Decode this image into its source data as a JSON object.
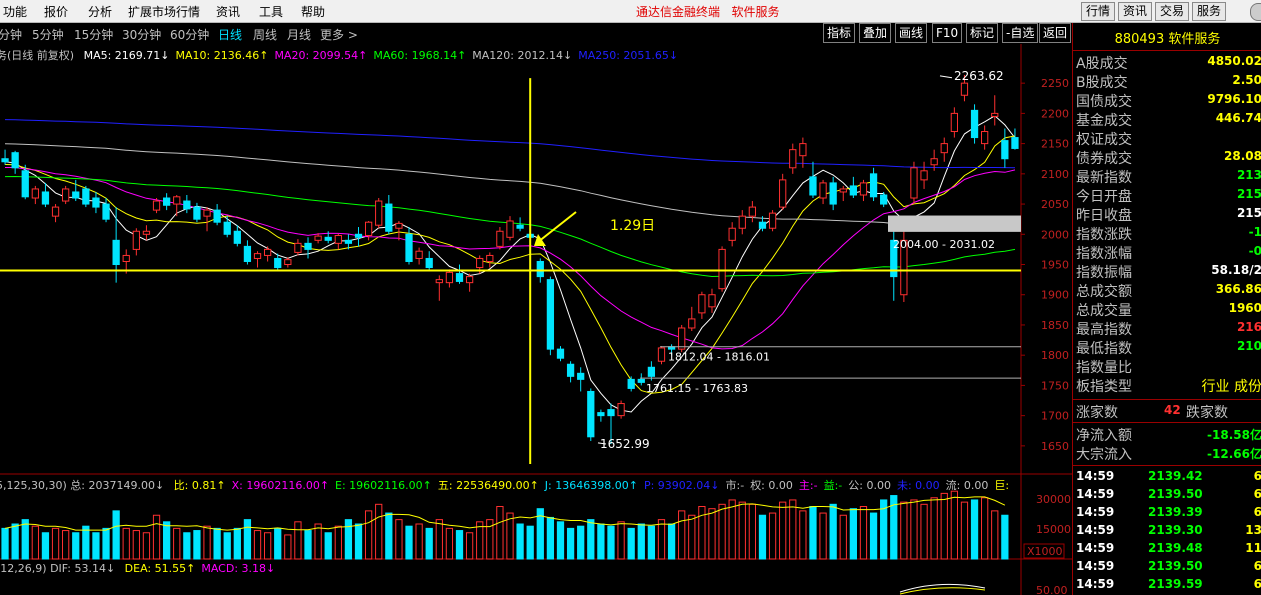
{
  "menu": [
    "功能",
    "报价",
    "分析",
    "扩展市场行情",
    "资讯",
    "工具",
    "帮助"
  ],
  "brand": "通达信金融终端",
  "brand_sub": "软件服务",
  "top_buttons": [
    "行情",
    "资讯",
    "交易",
    "服务"
  ],
  "periods": [
    "分钟",
    "5分钟",
    "15分钟",
    "30分钟",
    "60分钟",
    "日线",
    "周线",
    "月线",
    "更多 >"
  ],
  "active_period": "日线",
  "tools": [
    "指标",
    "叠加",
    "画线",
    "F10",
    "标记",
    "-自选",
    "返回"
  ],
  "ma_line": {
    "prefix": "务(日线 前复权)",
    "items": [
      {
        "label": "MA5: 2169.71↓",
        "color": "#ffffff"
      },
      {
        "label": "MA10: 2136.46↑",
        "color": "#ffff00"
      },
      {
        "label": "MA20: 2099.54↑",
        "color": "#ff00ff"
      },
      {
        "label": "MA60: 1968.14↑",
        "color": "#00ff00"
      },
      {
        "label": "MA120: 2012.14↓",
        "color": "#c0c0c0"
      },
      {
        "label": "MA250: 2051.65↓",
        "color": "#2020ff"
      }
    ]
  },
  "annotation": "1.29日",
  "price_labels": {
    "high": "2263.62",
    "low": "1652.99",
    "box1": "2004.00 - 2031.02",
    "box2": "1812.04 - 1816.01",
    "box3": "1761.15 - 1763.83"
  },
  "y_axis": [
    "2250",
    "2200",
    "2150",
    "2100",
    "2050",
    "2000",
    "1950",
    "1900",
    "1850",
    "1800",
    "1750",
    "1700",
    "1650"
  ],
  "vol_line": {
    "prefix": "5,125,30,30) 总: 2037149.00↓",
    "items": [
      {
        "label": "比: 0.81↑",
        "color": "#ffff00"
      },
      {
        "label": "X: 19602116.00↑",
        "color": "#ff00ff"
      },
      {
        "label": "E: 19602116.00↑",
        "color": "#00ff00"
      },
      {
        "label": "五: 22536490.00↑",
        "color": "#ffff00"
      },
      {
        "label": "J: 13646398.00↑",
        "color": "#00e0ff"
      },
      {
        "label": "P: 93902.04↓",
        "color": "#2020ff"
      },
      {
        "label": "市:-",
        "color": "#c0c0c0"
      },
      {
        "label": "权: 0.00",
        "color": "#c0c0c0"
      },
      {
        "label": "主:-",
        "color": "#ff00ff"
      },
      {
        "label": "益:-",
        "color": "#00ff00"
      },
      {
        "label": "公: 0.00",
        "color": "#c0c0c0"
      },
      {
        "label": "未: 0.00",
        "color": "#2020ff"
      },
      {
        "label": "流: 0.00",
        "color": "#c0c0c0"
      },
      {
        "label": "巨:",
        "color": "#ffff00"
      }
    ]
  },
  "vol_axis": [
    "30000",
    "15000"
  ],
  "vol_unit": "X1000",
  "macd_line": {
    "prefix": "(12,26,9) DIF: 53.14↓",
    "items": [
      {
        "label": "DEA: 51.55↑",
        "color": "#ffff00"
      },
      {
        "label": "MACD: 3.18↓",
        "color": "#ff00ff"
      }
    ]
  },
  "macd_axis": "50.00",
  "right_panel": {
    "code": "880493",
    "name": "软件服务",
    "rows": [
      {
        "label": "A股成交",
        "value": "4850.02",
        "color": "#ffff00"
      },
      {
        "label": "B股成交",
        "value": "2.50",
        "color": "#ffff00"
      },
      {
        "label": "国债成交",
        "value": "9796.10",
        "color": "#ffff00"
      },
      {
        "label": "基金成交",
        "value": "446.74",
        "color": "#ffff00"
      },
      {
        "label": "权证成交",
        "value": "",
        "color": "#ffff00"
      },
      {
        "label": "债券成交",
        "value": "28.08",
        "color": "#ffff00"
      },
      {
        "label": "最新指数",
        "value": "213",
        "color": "#00ff00"
      },
      {
        "label": "今日开盘",
        "value": "215",
        "color": "#00ff00"
      },
      {
        "label": "昨日收盘",
        "value": "215",
        "color": "#ffffff"
      },
      {
        "label": "指数涨跌",
        "value": "-1",
        "color": "#00ff00"
      },
      {
        "label": "指数涨幅",
        "value": "-0",
        "color": "#00ff00"
      },
      {
        "label": "指数振幅",
        "value": "58.18/2",
        "color": "#ffffff"
      },
      {
        "label": "总成交额",
        "value": "366.86",
        "color": "#ffff00"
      },
      {
        "label": "总成交量",
        "value": "1960",
        "color": "#ffff00"
      },
      {
        "label": "最高指数",
        "value": "216",
        "color": "#ff3030"
      },
      {
        "label": "最低指数",
        "value": "210",
        "color": "#00ff00"
      },
      {
        "label": "指数量比",
        "value": "",
        "color": "#ffffff"
      },
      {
        "label": "板指类型",
        "value": "行业 成份",
        "color": "#ffff00"
      }
    ],
    "up_label": "涨家数",
    "up_value": "42",
    "down_label": "跌家数",
    "net_label": "净流入额",
    "net_value": "-18.58亿",
    "block_label": "大宗流入",
    "block_value": "-12.66亿",
    "ticks": [
      {
        "time": "14:59",
        "price": "2139.42",
        "vol": "6"
      },
      {
        "time": "14:59",
        "price": "2139.50",
        "vol": "6"
      },
      {
        "time": "14:59",
        "price": "2139.39",
        "vol": "6"
      },
      {
        "time": "14:59",
        "price": "2139.30",
        "vol": "13"
      },
      {
        "time": "14:59",
        "price": "2139.48",
        "vol": "11"
      },
      {
        "time": "14:59",
        "price": "2139.50",
        "vol": "6"
      },
      {
        "time": "14:59",
        "price": "2139.59",
        "vol": "6"
      }
    ]
  },
  "chart_data": {
    "type": "candlestick",
    "y_range": [
      1620,
      2285
    ],
    "candles": [
      [
        2125,
        2140,
        2115,
        2120
      ],
      [
        2135,
        2138,
        2100,
        2110
      ],
      [
        2105,
        2115,
        2058,
        2062
      ],
      [
        2060,
        2080,
        2050,
        2075
      ],
      [
        2070,
        2085,
        2045,
        2050
      ],
      [
        2030,
        2050,
        2020,
        2045
      ],
      [
        2055,
        2080,
        2050,
        2075
      ],
      [
        2070,
        2090,
        2055,
        2060
      ],
      [
        2075,
        2080,
        2045,
        2050
      ],
      [
        2060,
        2070,
        2035,
        2045
      ],
      [
        2050,
        2060,
        2020,
        2025
      ],
      [
        1990,
        2045,
        1920,
        1950
      ],
      [
        1955,
        1975,
        1935,
        1965
      ],
      [
        1975,
        2010,
        1965,
        2005
      ],
      [
        2000,
        2015,
        1990,
        2005
      ],
      [
        2040,
        2060,
        2035,
        2055
      ],
      [
        2060,
        2068,
        2040,
        2048
      ],
      [
        2050,
        2065,
        2030,
        2062
      ],
      [
        2055,
        2065,
        2035,
        2042
      ],
      [
        2045,
        2052,
        2020,
        2025
      ],
      [
        2030,
        2045,
        2005,
        2040
      ],
      [
        2040,
        2050,
        2015,
        2020
      ],
      [
        2020,
        2030,
        1995,
        2000
      ],
      [
        2005,
        2015,
        1980,
        1985
      ],
      [
        1980,
        1990,
        1950,
        1955
      ],
      [
        1960,
        1972,
        1945,
        1968
      ],
      [
        1965,
        1980,
        1955,
        1975
      ],
      [
        1960,
        1968,
        1940,
        1945
      ],
      [
        1950,
        1962,
        1945,
        1958
      ],
      [
        1970,
        1992,
        1965,
        1985
      ],
      [
        1985,
        1995,
        1960,
        1975
      ],
      [
        1990,
        2002,
        1985,
        1997
      ],
      [
        1995,
        2005,
        1985,
        1990
      ],
      [
        1985,
        2001,
        1975,
        1998
      ],
      [
        1990,
        2000,
        1975,
        1985
      ],
      [
        2000,
        2012,
        1980,
        1995
      ],
      [
        1998,
        2022,
        1990,
        2020
      ],
      [
        2015,
        2060,
        2010,
        2055
      ],
      [
        2050,
        2065,
        2000,
        2005
      ],
      [
        2010,
        2022,
        1990,
        2018
      ],
      [
        2000,
        2012,
        1950,
        1955
      ],
      [
        1960,
        1978,
        1950,
        1972
      ],
      [
        1960,
        1972,
        1940,
        1945
      ],
      [
        1920,
        1932,
        1890,
        1925
      ],
      [
        1920,
        1942,
        1912,
        1937
      ],
      [
        1935,
        1950,
        1918,
        1922
      ],
      [
        1920,
        1935,
        1905,
        1930
      ],
      [
        1945,
        1965,
        1935,
        1960
      ],
      [
        1955,
        1970,
        1945,
        1965
      ],
      [
        1980,
        2012,
        1975,
        2005
      ],
      [
        1995,
        2030,
        1990,
        2022
      ],
      [
        2015,
        2028,
        2005,
        2010
      ],
      [
        2000,
        2010,
        1990,
        1995
      ],
      [
        1955,
        1960,
        1920,
        1930
      ],
      [
        1925,
        1930,
        1800,
        1810
      ],
      [
        1810,
        1815,
        1790,
        1795
      ],
      [
        1785,
        1790,
        1755,
        1765
      ],
      [
        1770,
        1780,
        1740,
        1760
      ],
      [
        1740,
        1745,
        1658,
        1665
      ],
      [
        1705,
        1710,
        1690,
        1700
      ],
      [
        1710,
        1720,
        1652.99,
        1700
      ],
      [
        1700,
        1725,
        1695,
        1720
      ],
      [
        1760,
        1765,
        1740,
        1745
      ],
      [
        1760,
        1770,
        1750,
        1755
      ],
      [
        1780,
        1790,
        1758,
        1765
      ],
      [
        1790,
        1815,
        1785,
        1812
      ],
      [
        1814,
        1818,
        1800,
        1810
      ],
      [
        1810,
        1850,
        1805,
        1845
      ],
      [
        1845,
        1880,
        1840,
        1860
      ],
      [
        1870,
        1905,
        1860,
        1900
      ],
      [
        1880,
        1910,
        1870,
        1900
      ],
      [
        1910,
        1980,
        1905,
        1975
      ],
      [
        1990,
        2020,
        1980,
        2010
      ],
      [
        2010,
        2040,
        2000,
        2030
      ],
      [
        2030,
        2055,
        2020,
        2045
      ],
      [
        2020,
        2030,
        2005,
        2010
      ],
      [
        2010,
        2040,
        2005,
        2035
      ],
      [
        2045,
        2100,
        2040,
        2090
      ],
      [
        2110,
        2150,
        2100,
        2140
      ],
      [
        2130,
        2160,
        2110,
        2150
      ],
      [
        2095,
        2120,
        2060,
        2065
      ],
      [
        2060,
        2090,
        2050,
        2085
      ],
      [
        2085,
        2095,
        2040,
        2050
      ],
      [
        2070,
        2080,
        2055,
        2075
      ],
      [
        2080,
        2095,
        2060,
        2065
      ],
      [
        2065,
        2090,
        2055,
        2085
      ],
      [
        2100,
        2110,
        2055,
        2062
      ],
      [
        2065,
        2070,
        2045,
        2050
      ],
      [
        1990,
        2010,
        1890,
        1930
      ],
      [
        1900,
        2025,
        1888,
        1990
      ],
      [
        2060,
        2120,
        2050,
        2110
      ],
      [
        2090,
        2120,
        2075,
        2105
      ],
      [
        2115,
        2140,
        2105,
        2125
      ],
      [
        2135,
        2160,
        2120,
        2150
      ],
      [
        2170,
        2210,
        2160,
        2200
      ],
      [
        2230,
        2263.62,
        2220,
        2250
      ],
      [
        2205,
        2215,
        2150,
        2160
      ],
      [
        2150,
        2180,
        2140,
        2170
      ],
      [
        2195,
        2230,
        2180,
        2200
      ],
      [
        2155,
        2175,
        2110,
        2125
      ],
      [
        2160,
        2175,
        2140,
        2142
      ]
    ],
    "ma_series": [
      {
        "name": "MA5",
        "color": "#ffffff"
      },
      {
        "name": "MA10",
        "color": "#ffff00"
      },
      {
        "name": "MA20",
        "color": "#ff00ff"
      },
      {
        "name": "MA60",
        "color": "#00ff00"
      },
      {
        "name": "MA120",
        "color": "#c0c0c0"
      },
      {
        "name": "MA250",
        "color": "#2020ff"
      }
    ],
    "volume": [
      14,
      16,
      18,
      15,
      12,
      14,
      13,
      12,
      15,
      12,
      14,
      22,
      14,
      13,
      12,
      20,
      17,
      14,
      12,
      13,
      15,
      14,
      12,
      14,
      18,
      13,
      12,
      14,
      11,
      17,
      13,
      16,
      12,
      15,
      18,
      16,
      22,
      25,
      21,
      18,
      15,
      16,
      14,
      18,
      14,
      13,
      12,
      17,
      18,
      24,
      21,
      16,
      15,
      23,
      19,
      17,
      14,
      15,
      18,
      16,
      15,
      17,
      14,
      16,
      15,
      18,
      16,
      22,
      20,
      24,
      23,
      25,
      27,
      26,
      25,
      20,
      21,
      26,
      27,
      22,
      24,
      21,
      25,
      20,
      23,
      24,
      21,
      27,
      29,
      26,
      27,
      25,
      28,
      30,
      31,
      26,
      27,
      28,
      22,
      20
    ]
  }
}
